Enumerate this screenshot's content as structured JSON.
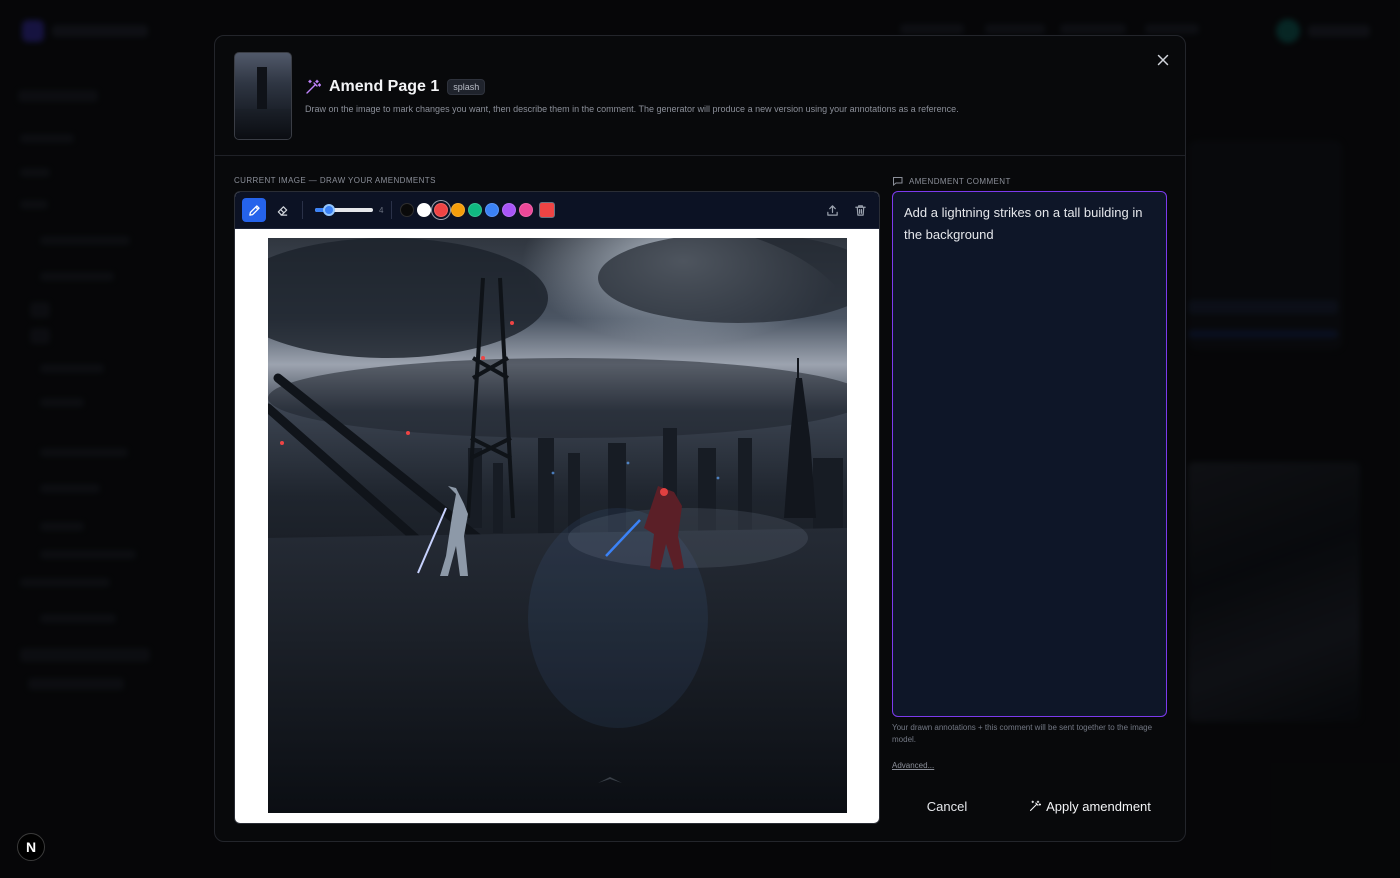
{
  "modal": {
    "title": "Amend Page 1",
    "tag": "splash",
    "description": "Draw on the image to mark changes you want, then describe them in the comment. The generator will produce a new version using your annotations as a reference.",
    "close_icon": "close-icon",
    "title_icon": "magic-wand-icon"
  },
  "canvas": {
    "section_label": "CURRENT IMAGE — DRAW YOUR AMENDMENTS",
    "toolbar": {
      "tools": [
        {
          "name": "pencil",
          "icon": "pencil-icon",
          "active": true
        },
        {
          "name": "eraser",
          "icon": "eraser-icon",
          "active": false
        }
      ],
      "brush_size": 4,
      "brush_size_max": 24,
      "colors": [
        "#0a0a0a",
        "#ffffff",
        "#ef4444",
        "#f59e0b",
        "#10b981",
        "#3b82f6",
        "#a855f7",
        "#ec4899"
      ],
      "selected_color": "#ef4444",
      "custom_color": "#ef4444",
      "actions": [
        {
          "name": "export",
          "icon": "upload-icon"
        },
        {
          "name": "clear",
          "icon": "trash-icon"
        }
      ]
    }
  },
  "comment": {
    "section_label": "AMENDMENT COMMENT",
    "section_icon": "comment-icon",
    "value": "Add a lightning strikes on a tall building in the background",
    "hint": "Your drawn annotations + this comment will be sent together to the image model.",
    "advanced_label": "Advanced..."
  },
  "actions": {
    "cancel_label": "Cancel",
    "apply_label": "Apply amendment",
    "apply_icon": "magic-wand-icon"
  },
  "colors": {
    "accent": "#2563eb",
    "focus_ring": "#7c3aed",
    "panel": "#0e1628",
    "toolbar": "#0c1224"
  },
  "badge": {
    "label": "N"
  }
}
